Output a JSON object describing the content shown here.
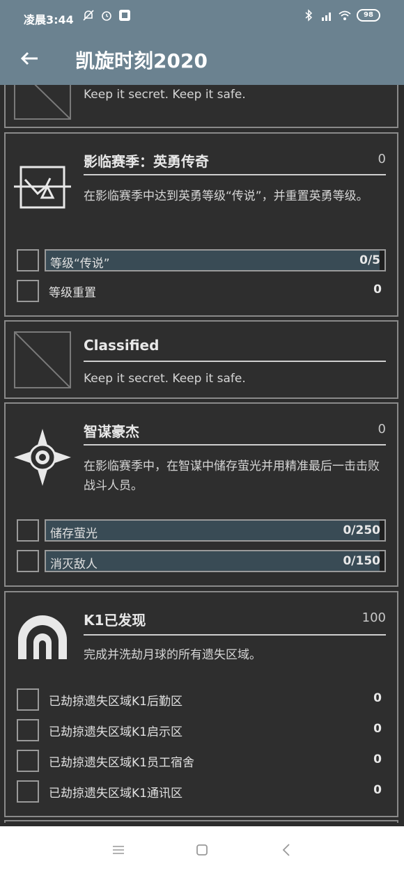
{
  "status": {
    "time": "凌晨3:44",
    "battery": "98"
  },
  "appbar": {
    "title": "凯旋时刻2020"
  },
  "cards": [
    {
      "name": "",
      "points": "",
      "desc": "Keep it secret.  Keep it safe."
    },
    {
      "name": "影临赛季：英勇传奇",
      "points": "0",
      "desc": "在影临赛季中达到英勇等级“传说”，并重置英勇等级。",
      "objectives": [
        {
          "label": "等级“传说”",
          "value": "0/5",
          "progress": 0.985
        },
        {
          "label": "等级重置",
          "value": "0"
        }
      ]
    },
    {
      "name": "Classified",
      "points": "",
      "desc": "Keep it secret.  Keep it safe."
    },
    {
      "name": "智谋豪杰",
      "points": "0",
      "desc": "在影临赛季中，在智谋中储存萤光并用精准最后一击击败战斗人员。",
      "objectives": [
        {
          "label": "储存萤光",
          "value": "0/250",
          "progress": 0.985
        },
        {
          "label": "消灭敌人",
          "value": "0/150",
          "progress": 0.985
        }
      ]
    },
    {
      "name": "K1已发现",
      "points": "100",
      "desc": "完成并洗劫月球的所有遗失区域。",
      "objectives": [
        {
          "label": "已劫掠遗失区域K1后勤区",
          "value": "0"
        },
        {
          "label": "已劫掠遗失区域K1启示区",
          "value": "0"
        },
        {
          "label": "已劫掠遗失区域K1员工宿舍",
          "value": "0"
        },
        {
          "label": "已劫掠遗失区域K1通讯区",
          "value": "0"
        }
      ]
    }
  ]
}
